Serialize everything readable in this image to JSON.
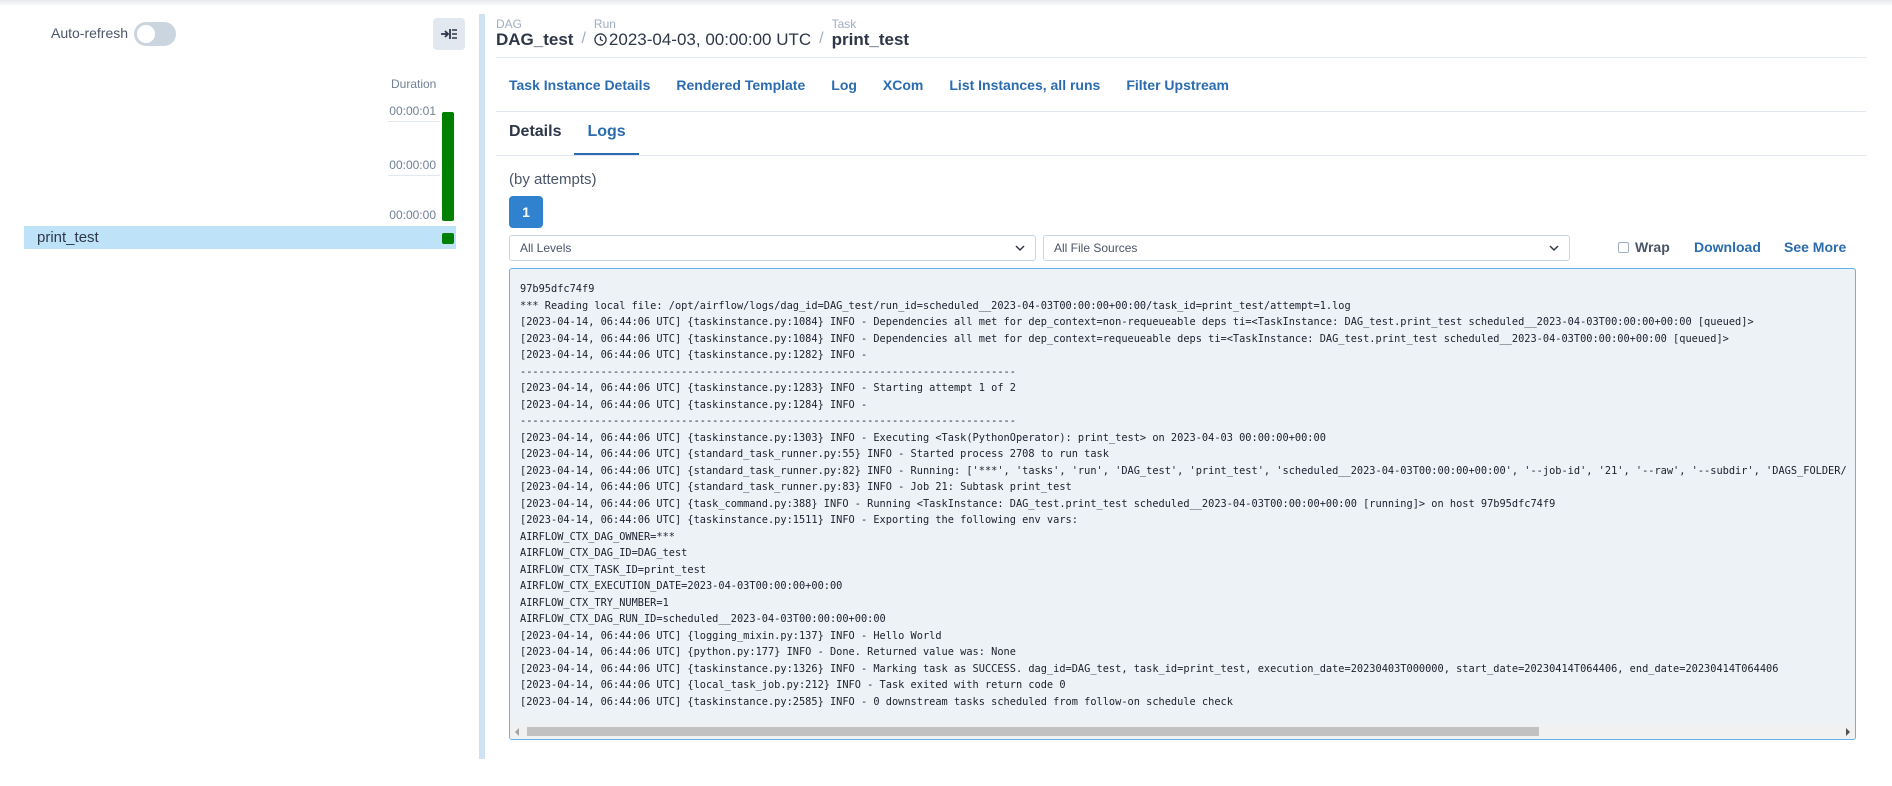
{
  "grid": {
    "auto_refresh_label": "Auto-refresh",
    "auto_refresh_on": false,
    "duration_header": "Duration",
    "duration_ticks": [
      "00:00:01",
      "00:00:00",
      "00:00:00"
    ],
    "task_name": "print_test",
    "task_state_color": "#008000",
    "selected_row_color": "#bee3f8"
  },
  "breadcrumb": {
    "dag_label": "DAG",
    "dag_value": "DAG_test",
    "run_label": "Run",
    "run_value": "2023-04-03, 00:00:00 UTC",
    "task_label": "Task",
    "task_value": "print_test",
    "separator": "/"
  },
  "nav_links": [
    "Task Instance Details",
    "Rendered Template",
    "Log",
    "XCom",
    "List Instances, all runs",
    "Filter Upstream"
  ],
  "tabs": {
    "details": "Details",
    "logs": "Logs",
    "active": "Logs"
  },
  "logs": {
    "attempts_label": "(by attempts)",
    "attempt_number": "1",
    "level_select": "All Levels",
    "source_select": "All File Sources",
    "wrap_label": "Wrap",
    "wrap_checked": false,
    "download_label": "Download",
    "see_more_label": "See More",
    "accent_color": "#2b6cb0",
    "lines": [
      "97b95dfc74f9",
      "*** Reading local file: /opt/airflow/logs/dag_id=DAG_test/run_id=scheduled__2023-04-03T00:00:00+00:00/task_id=print_test/attempt=1.log",
      "[2023-04-14, 06:44:06 UTC] {taskinstance.py:1084} INFO - Dependencies all met for dep_context=non-requeueable deps ti=<TaskInstance: DAG_test.print_test scheduled__2023-04-03T00:00:00+00:00 [queued]>",
      "[2023-04-14, 06:44:06 UTC] {taskinstance.py:1084} INFO - Dependencies all met for dep_context=requeueable deps ti=<TaskInstance: DAG_test.print_test scheduled__2023-04-03T00:00:00+00:00 [queued]>",
      "[2023-04-14, 06:44:06 UTC] {taskinstance.py:1282} INFO - ",
      "--------------------------------------------------------------------------------",
      "[2023-04-14, 06:44:06 UTC] {taskinstance.py:1283} INFO - Starting attempt 1 of 2",
      "[2023-04-14, 06:44:06 UTC] {taskinstance.py:1284} INFO - ",
      "--------------------------------------------------------------------------------",
      "[2023-04-14, 06:44:06 UTC] {taskinstance.py:1303} INFO - Executing <Task(PythonOperator): print_test> on 2023-04-03 00:00:00+00:00",
      "[2023-04-14, 06:44:06 UTC] {standard_task_runner.py:55} INFO - Started process 2708 to run task",
      "[2023-04-14, 06:44:06 UTC] {standard_task_runner.py:82} INFO - Running: ['***', 'tasks', 'run', 'DAG_test', 'print_test', 'scheduled__2023-04-03T00:00:00+00:00', '--job-id', '21', '--raw', '--subdir', 'DAGS_FOLDER/",
      "[2023-04-14, 06:44:06 UTC] {standard_task_runner.py:83} INFO - Job 21: Subtask print_test",
      "[2023-04-14, 06:44:06 UTC] {task_command.py:388} INFO - Running <TaskInstance: DAG_test.print_test scheduled__2023-04-03T00:00:00+00:00 [running]> on host 97b95dfc74f9",
      "[2023-04-14, 06:44:06 UTC] {taskinstance.py:1511} INFO - Exporting the following env vars:",
      "AIRFLOW_CTX_DAG_OWNER=***",
      "AIRFLOW_CTX_DAG_ID=DAG_test",
      "AIRFLOW_CTX_TASK_ID=print_test",
      "AIRFLOW_CTX_EXECUTION_DATE=2023-04-03T00:00:00+00:00",
      "AIRFLOW_CTX_TRY_NUMBER=1",
      "AIRFLOW_CTX_DAG_RUN_ID=scheduled__2023-04-03T00:00:00+00:00",
      "[2023-04-14, 06:44:06 UTC] {logging_mixin.py:137} INFO - Hello World",
      "[2023-04-14, 06:44:06 UTC] {python.py:177} INFO - Done. Returned value was: None",
      "[2023-04-14, 06:44:06 UTC] {taskinstance.py:1326} INFO - Marking task as SUCCESS. dag_id=DAG_test, task_id=print_test, execution_date=20230403T000000, start_date=20230414T064406, end_date=20230414T064406",
      "[2023-04-14, 06:44:06 UTC] {local_task_job.py:212} INFO - Task exited with return code 0",
      "[2023-04-14, 06:44:06 UTC] {taskinstance.py:2585} INFO - 0 downstream tasks scheduled from follow-on schedule check"
    ]
  }
}
